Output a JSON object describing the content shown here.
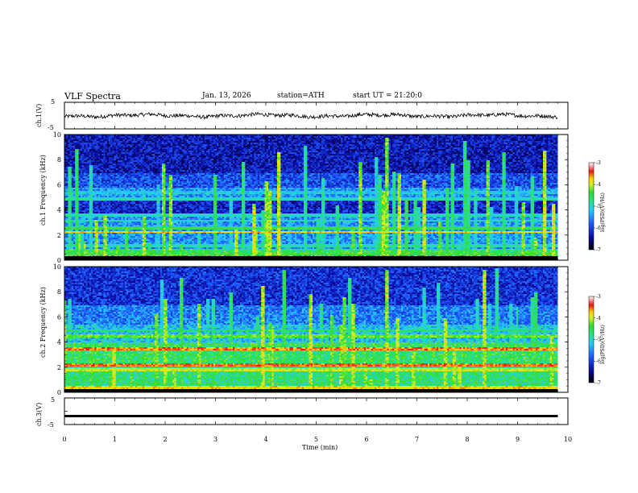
{
  "header": {
    "title": "VLF Spectra",
    "date": "Jan. 13, 2026",
    "station": "station=ATH",
    "start": "start UT =  21:20:0"
  },
  "chart_data": [
    {
      "type": "line",
      "panel": "ch1-waveform",
      "ylabel": "ch.1(V)",
      "ylim": [
        -5,
        5
      ],
      "yticks": [
        "5",
        "-5"
      ],
      "x_range_min": [
        0,
        9.8
      ],
      "description_level_V": 0
    },
    {
      "type": "heatmap",
      "panel": "ch1-spectrogram",
      "ylabel": "ch.1 Frequency (kHz)",
      "ylim": [
        0,
        10
      ],
      "yticks": [
        "0",
        "2",
        "4",
        "6",
        "8",
        "10"
      ],
      "colorbar": {
        "label": "log(PSD)(V²/Hz)",
        "ticks": [
          "-3",
          "-4",
          "-5",
          "-6",
          "-7"
        ],
        "range": [
          -7,
          -3
        ]
      },
      "bands_kHz": [
        {
          "f": 0.3,
          "level": -3.5
        },
        {
          "f": 0.6,
          "level": -4.5
        },
        {
          "f": 1.2,
          "level": -5.0
        },
        {
          "f": 2.3,
          "level": -3.8
        },
        {
          "f": 2.6,
          "level": -4.6
        },
        {
          "f": 3.2,
          "level": -5.0
        },
        {
          "f": 3.7,
          "level": -5.0
        },
        {
          "f": 4.9,
          "level": -5.0
        },
        {
          "f": 5.5,
          "level": -5.2
        }
      ]
    },
    {
      "type": "heatmap",
      "panel": "ch2-spectrogram",
      "ylabel": "ch.2 Frequency (kHz)",
      "ylim": [
        0,
        10
      ],
      "yticks": [
        "0",
        "2",
        "4",
        "6",
        "8",
        "10"
      ],
      "colorbar": {
        "label": "log(PSD)(V²/Hz)",
        "ticks": [
          "-3",
          "-4",
          "-5",
          "-6",
          "-7"
        ],
        "range": [
          -7,
          -3
        ]
      },
      "bands_kHz": [
        {
          "f": 0.4,
          "level": -3.8
        },
        {
          "f": 1.9,
          "level": -4.0
        },
        {
          "f": 2.2,
          "level": -3.5
        },
        {
          "f": 3.5,
          "level": -3.6
        },
        {
          "f": 4.5,
          "level": -4.3
        },
        {
          "f": 5.0,
          "level": -4.6
        }
      ]
    },
    {
      "type": "line",
      "panel": "ch3-waveform",
      "ylabel": "ch.3(V)",
      "ylim": [
        -5,
        5
      ],
      "yticks": [
        "5",
        "0",
        "-5"
      ],
      "description_level_V": -1.8,
      "xlabel": "Time (min)",
      "xlim": [
        0,
        10
      ],
      "xticks": [
        "0",
        "1",
        "2",
        "3",
        "4",
        "5",
        "6",
        "7",
        "8",
        "9",
        "10"
      ]
    }
  ]
}
